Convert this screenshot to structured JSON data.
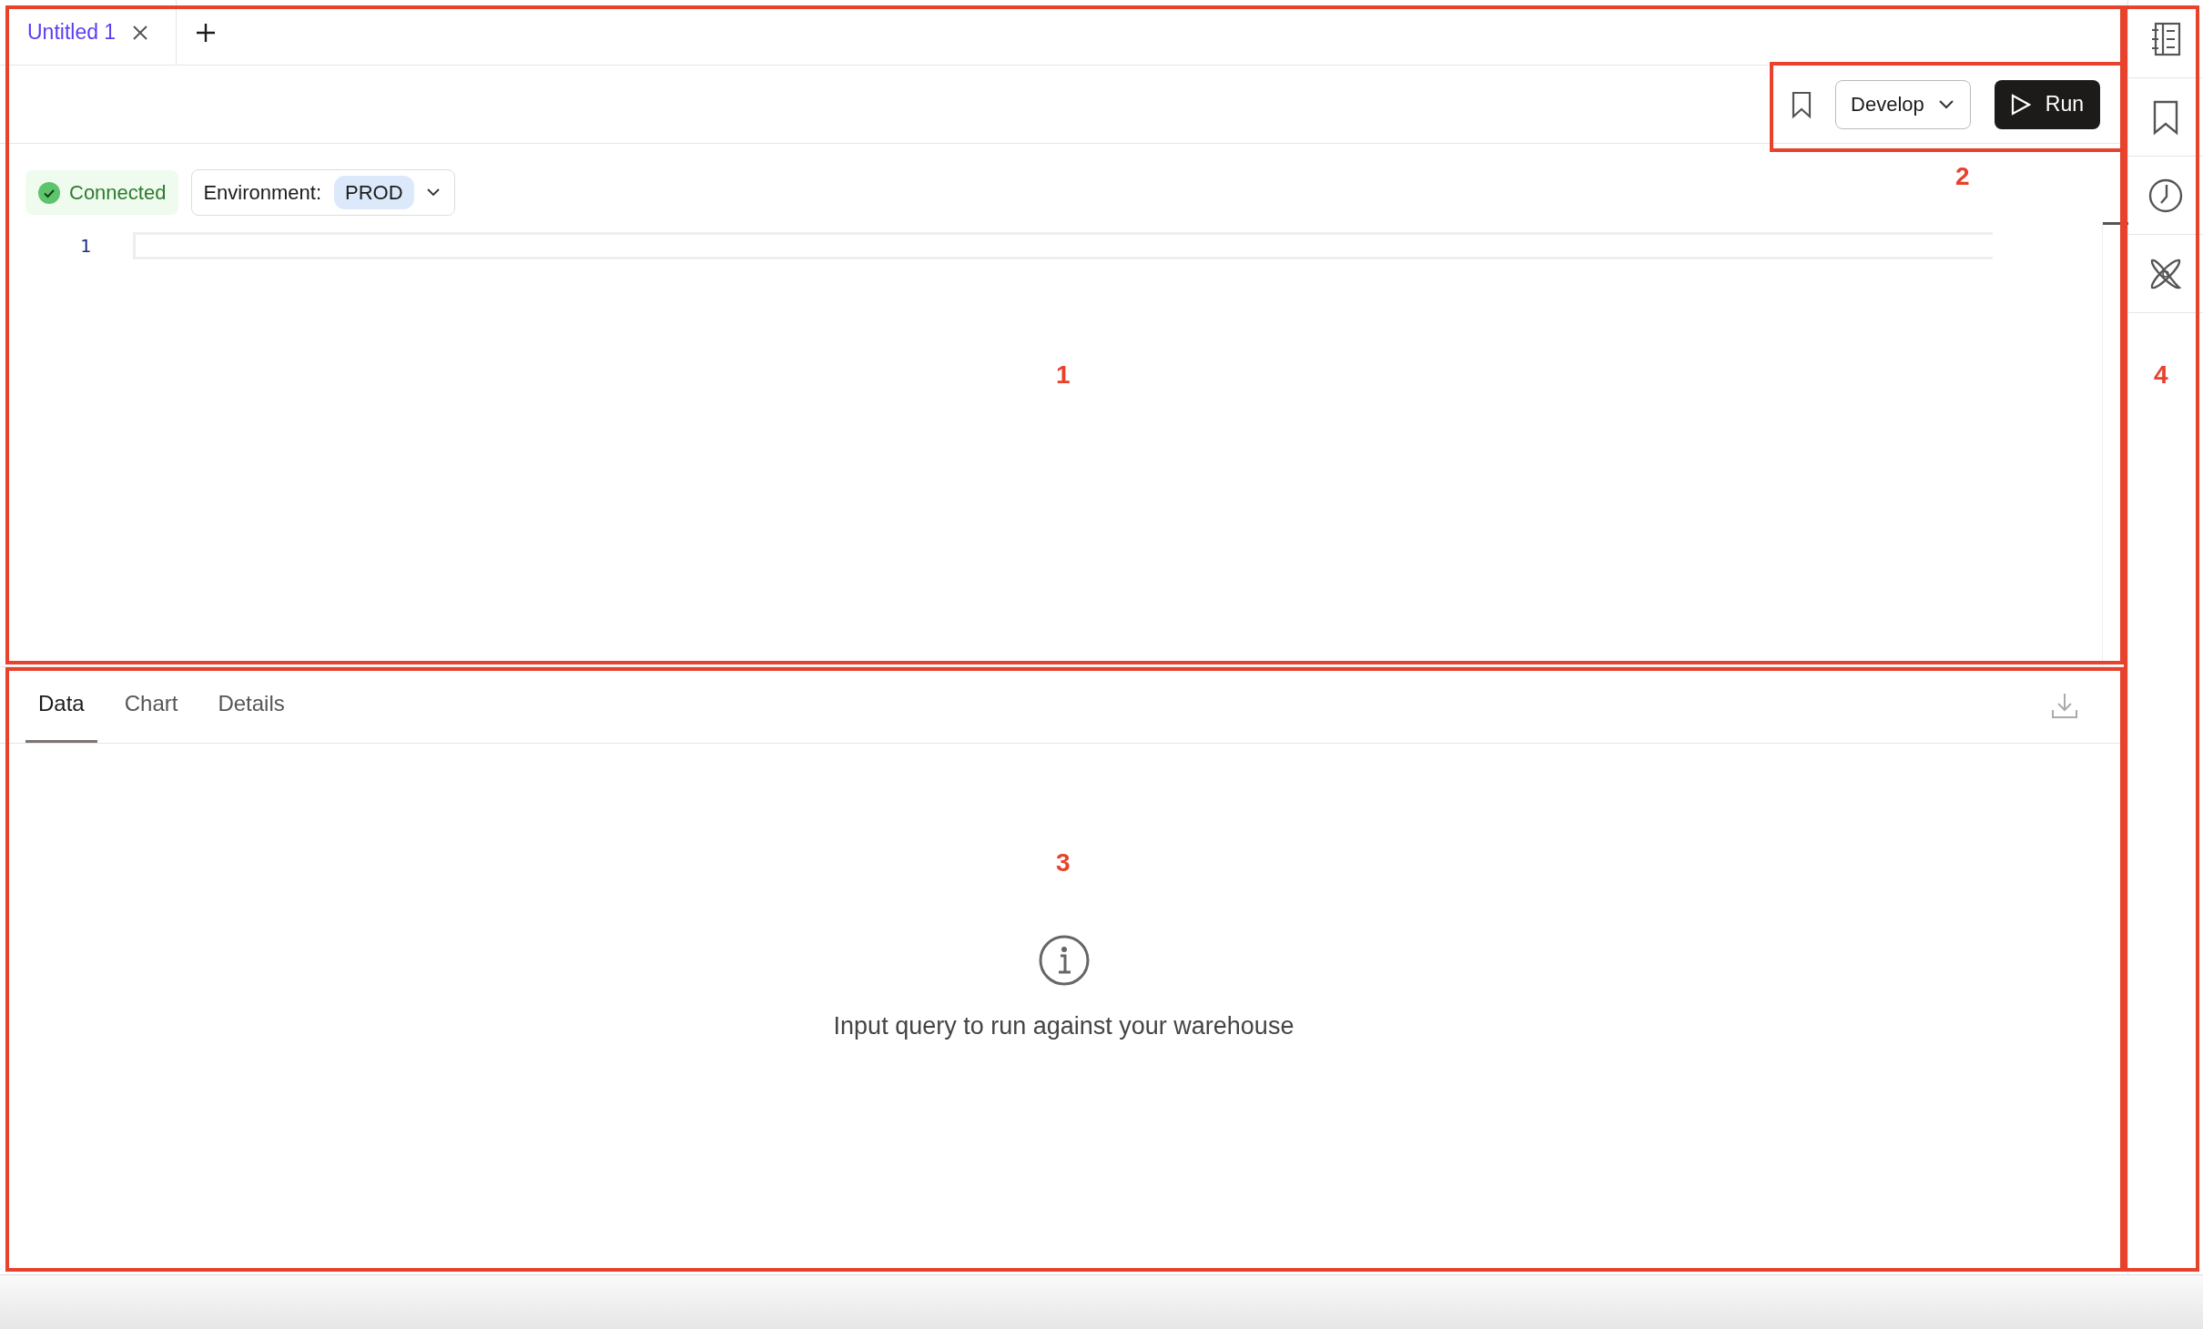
{
  "tabs": [
    {
      "label": "Untitled 1",
      "selected": true
    }
  ],
  "toolbar": {
    "mode": "Develop",
    "run_label": "Run"
  },
  "status": {
    "connection": "Connected",
    "environment_label": "Environment:",
    "environment": "PROD"
  },
  "editor": {
    "line_numbers": [
      "1"
    ]
  },
  "results": {
    "tabs": [
      {
        "label": "Data",
        "selected": true
      },
      {
        "label": "Chart",
        "selected": false
      },
      {
        "label": "Details",
        "selected": false
      }
    ],
    "empty_message": "Input query to run against your warehouse"
  },
  "sidebar": {
    "items": [
      {
        "kind": "notebook"
      },
      {
        "kind": "bookmark"
      },
      {
        "kind": "history"
      },
      {
        "kind": "dbt"
      }
    ]
  },
  "annotations": [
    {
      "label": "1"
    },
    {
      "label": "2"
    },
    {
      "label": "3"
    },
    {
      "label": "4"
    }
  ]
}
